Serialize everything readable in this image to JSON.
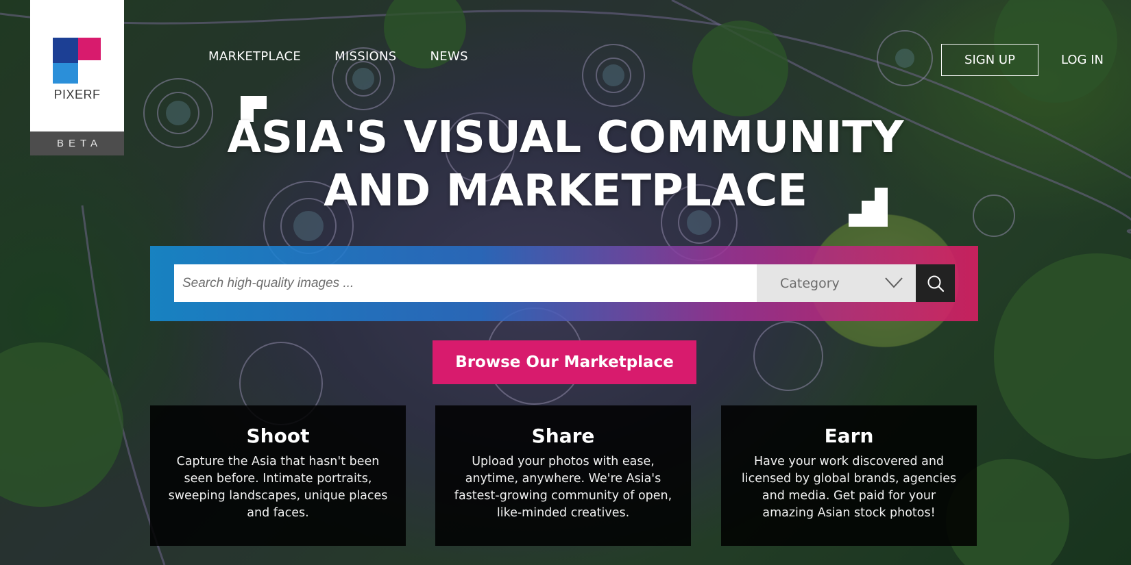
{
  "brand": {
    "name": "PIXERF",
    "badge": "BETA",
    "colors": {
      "navy": "#1c3f94",
      "pink": "#d81b6d",
      "blue": "#2b8fd9"
    }
  },
  "nav": {
    "items": [
      "MARKETPLACE",
      "MISSIONS",
      "NEWS"
    ]
  },
  "auth": {
    "signup_label": "SIGN UP",
    "login_label": "LOG IN"
  },
  "hero": {
    "line1": "ASIA'S VISUAL COMMUNITY",
    "line2": "AND MARKETPLACE"
  },
  "search": {
    "placeholder": "Search high-quality images ...",
    "category_label": "Category",
    "category_icon": "chevron-down-icon",
    "button_icon": "search-icon"
  },
  "browse_label": "Browse Our Marketplace",
  "features": [
    {
      "title": "Shoot",
      "text": "Capture the Asia that hasn't been seen before. Intimate portraits, sweeping landscapes, unique places and faces."
    },
    {
      "title": "Share",
      "text": "Upload your photos with ease, anytime, anywhere. We're Asia's fastest-growing community of open, like-minded creatives."
    },
    {
      "title": "Earn",
      "text": "Have your work discovered and licensed by global brands, agencies and media. Get paid for your amazing Asian stock photos!"
    }
  ]
}
